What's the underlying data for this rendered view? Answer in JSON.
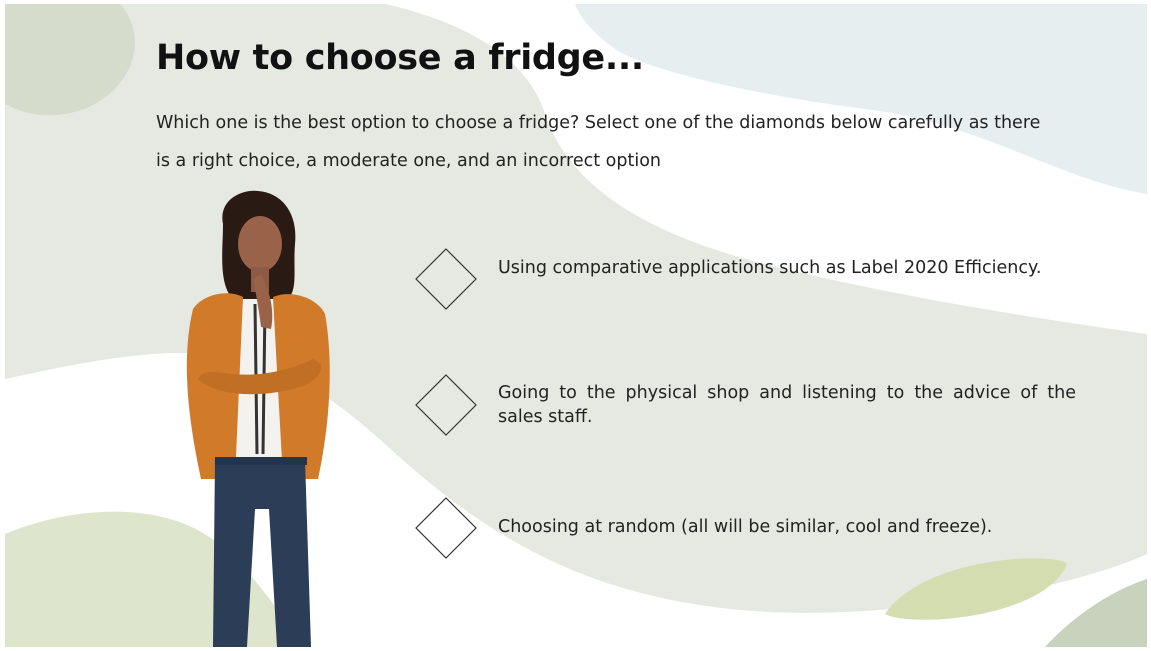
{
  "slide": {
    "title": "How to choose a fridge...",
    "subtitle": "Which one is the best option to choose a fridge? Select one of the diamonds below carefully as there is a right choice, a moderate one, and an incorrect option"
  },
  "options": [
    {
      "label": "Using comparative applications such as Label 2020 Efficiency."
    },
    {
      "label": "Going to the physical shop and listening to the advice of the sales staff."
    },
    {
      "label": "Choosing at random (all will be similar, cool and freeze)."
    }
  ],
  "colors": {
    "background_sage": "#e6e9e1",
    "accent_blue": "#e6eeef",
    "accent_green": "#d6dfc0",
    "cardigan": "#d07a2a",
    "jeans": "#2b3d57"
  },
  "icons": [
    "diamond-icon"
  ]
}
